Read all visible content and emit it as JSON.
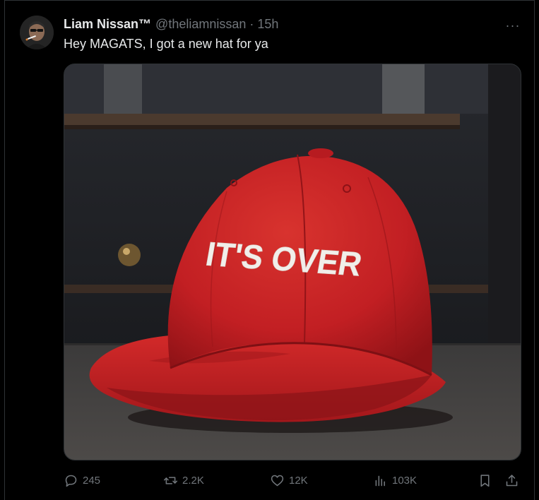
{
  "tweet": {
    "author_name": "Liam Nissan™",
    "handle": "@theliamnissan",
    "separator": "·",
    "time_ago": "15h",
    "more_label": "···",
    "text": "Hey MAGATS, I got a new hat for ya",
    "image_text": "IT'S OVER"
  },
  "actions": {
    "replies": "245",
    "reposts": "2.2K",
    "likes": "12K",
    "views": "103K"
  },
  "colors": {
    "background": "#000000",
    "text": "#e7e9ea",
    "muted": "#71767b",
    "border": "#2f3336",
    "cap_red": "#c71f24"
  }
}
